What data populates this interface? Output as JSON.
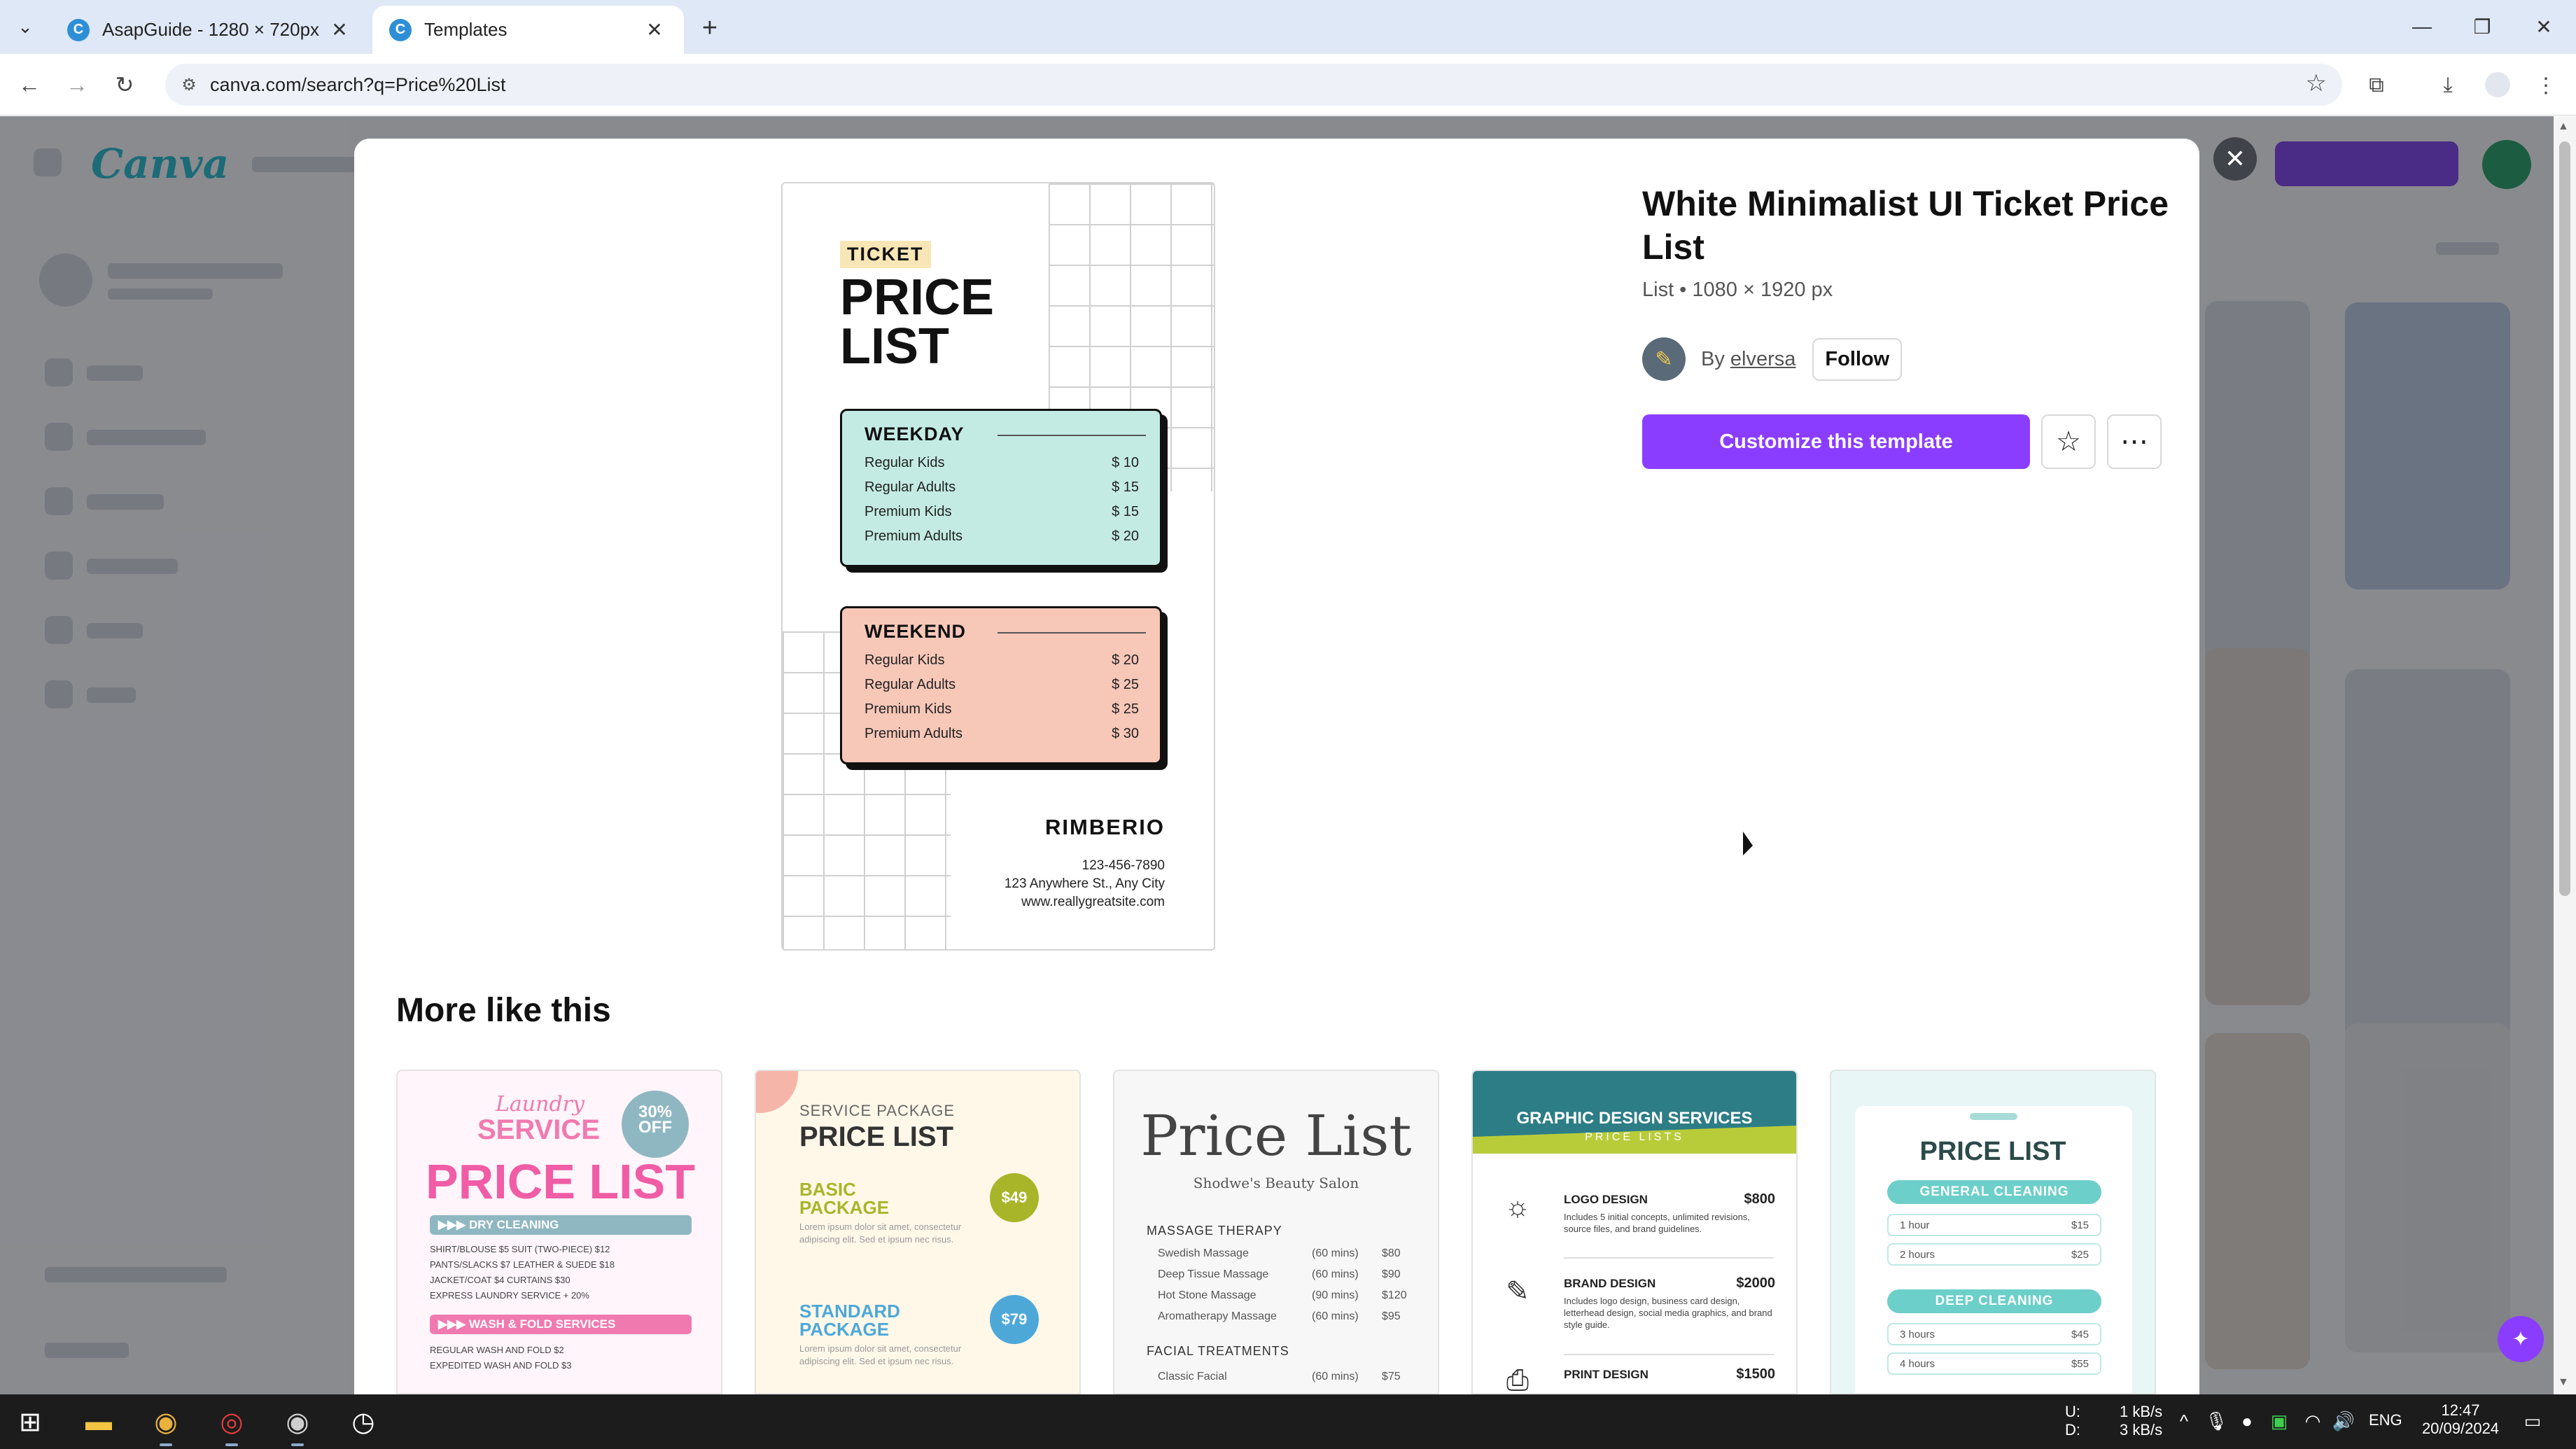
{
  "browser": {
    "tabs": [
      {
        "title": "AsapGuide - 1280 × 720px",
        "active": false
      },
      {
        "title": "Templates",
        "active": true
      }
    ],
    "url": "canva.com/search?q=Price%20List"
  },
  "template": {
    "title": "White Minimalist UI Ticket Price List",
    "meta": "List • 1080 × 1920 px",
    "by_prefix": "By",
    "author": "elversa",
    "follow_label": "Follow",
    "customize_label": "Customize this template"
  },
  "preview": {
    "tag": "TICKET",
    "headline_line1": "PRICE",
    "headline_line2": "LIST",
    "sections": [
      {
        "title": "WEEKDAY",
        "rows": [
          {
            "name": "Regular Kids",
            "price": "$ 10"
          },
          {
            "name": "Regular Adults",
            "price": "$ 15"
          },
          {
            "name": "Premium Kids",
            "price": "$ 15"
          },
          {
            "name": "Premium Adults",
            "price": "$ 20"
          }
        ]
      },
      {
        "title": "WEEKEND",
        "rows": [
          {
            "name": "Regular Kids",
            "price": "$ 20"
          },
          {
            "name": "Regular Adults",
            "price": "$ 25"
          },
          {
            "name": "Premium Kids",
            "price": "$ 25"
          },
          {
            "name": "Premium Adults",
            "price": "$ 30"
          }
        ]
      }
    ],
    "brand": "RIMBERIO",
    "phone": "123-456-7890",
    "address": "123 Anywhere St., Any City",
    "website": "www.reallygreatsite.com"
  },
  "more": {
    "title": "More like this",
    "card1": {
      "line1": "Laundry",
      "line2": "SERVICE",
      "badge1": "30%",
      "badge2": "OFF",
      "big": "PRICE LIST",
      "bar1": "▶▶▶ DRY CLEANING",
      "rows1": [
        "SHIRT/BLOUSE $5   SUIT (TWO-PIECE) $12",
        "PANTS/SLACKS $7   LEATHER & SUEDE $18",
        "JACKET/COAT $4   CURTAINS $30",
        "EXPRESS LAUNDRY SERVICE + 20%"
      ],
      "bar2": "▶▶▶ WASH & FOLD SERVICES",
      "rows2": [
        "REGULAR WASH AND FOLD $2",
        "EXPEDITED WASH AND FOLD $3"
      ]
    },
    "card2": {
      "small": "SERVICE PACKAGE",
      "title": "PRICE LIST",
      "pkg1": "BASIC\nPACKAGE",
      "price1": "$49",
      "pkg2": "STANDARD\nPACKAGE",
      "price2": "$79",
      "lorem": "Lorem ipsum dolor sit amet, consectetur adipiscing elit. Sed et ipsum nec risus."
    },
    "card3": {
      "title": "Price List",
      "subtitle": "Shodwe's Beauty Salon",
      "sec1": "MASSAGE THERAPY",
      "rows1": [
        {
          "n": "Swedish Massage",
          "t": "(60 mins)",
          "p": "$80"
        },
        {
          "n": "Deep Tissue Massage",
          "t": "(60 mins)",
          "p": "$90"
        },
        {
          "n": "Hot Stone Massage",
          "t": "(90 mins)",
          "p": "$120"
        },
        {
          "n": "Aromatherapy Massage",
          "t": "(60 mins)",
          "p": "$95"
        }
      ],
      "sec2": "FACIAL TREATMENTS",
      "rows2": [
        {
          "n": "Classic Facial",
          "t": "(60 mins)",
          "p": "$75"
        }
      ]
    },
    "card4": {
      "title": "GRAPHIC DESIGN SERVICES",
      "subtitle": "PRICE LISTS",
      "items": [
        {
          "name": "LOGO DESIGN",
          "price": "$800",
          "desc": "Includes 5 initial concepts, unlimited revisions, source files, and brand guidelines."
        },
        {
          "name": "BRAND DESIGN",
          "price": "$2000",
          "desc": "Includes logo design, business card design, letterhead design, social media graphics, and brand style guide."
        },
        {
          "name": "PRINT DESIGN",
          "price": "$1500",
          "desc": ""
        }
      ]
    },
    "card5": {
      "title": "PRICE LIST",
      "sec1": "GENERAL CLEANING",
      "rows1": [
        {
          "l": "1 hour",
          "p": "$15"
        },
        {
          "l": "2 hours",
          "p": "$25"
        }
      ],
      "sec2": "DEEP CLEANING",
      "rows2": [
        {
          "l": "3 hours",
          "p": "$45"
        },
        {
          "l": "4 hours",
          "p": "$55"
        }
      ]
    }
  },
  "taskbar": {
    "net_up_label": "U:",
    "net_down_label": "D:",
    "net_up": "1 kB/s",
    "net_down": "3 kB/s",
    "lang": "ENG",
    "time": "12:47",
    "date": "20/09/2024"
  },
  "colors": {
    "accent": "#8b3dff",
    "weekday": "#c3ebe4",
    "weekend": "#f7c7b8"
  }
}
